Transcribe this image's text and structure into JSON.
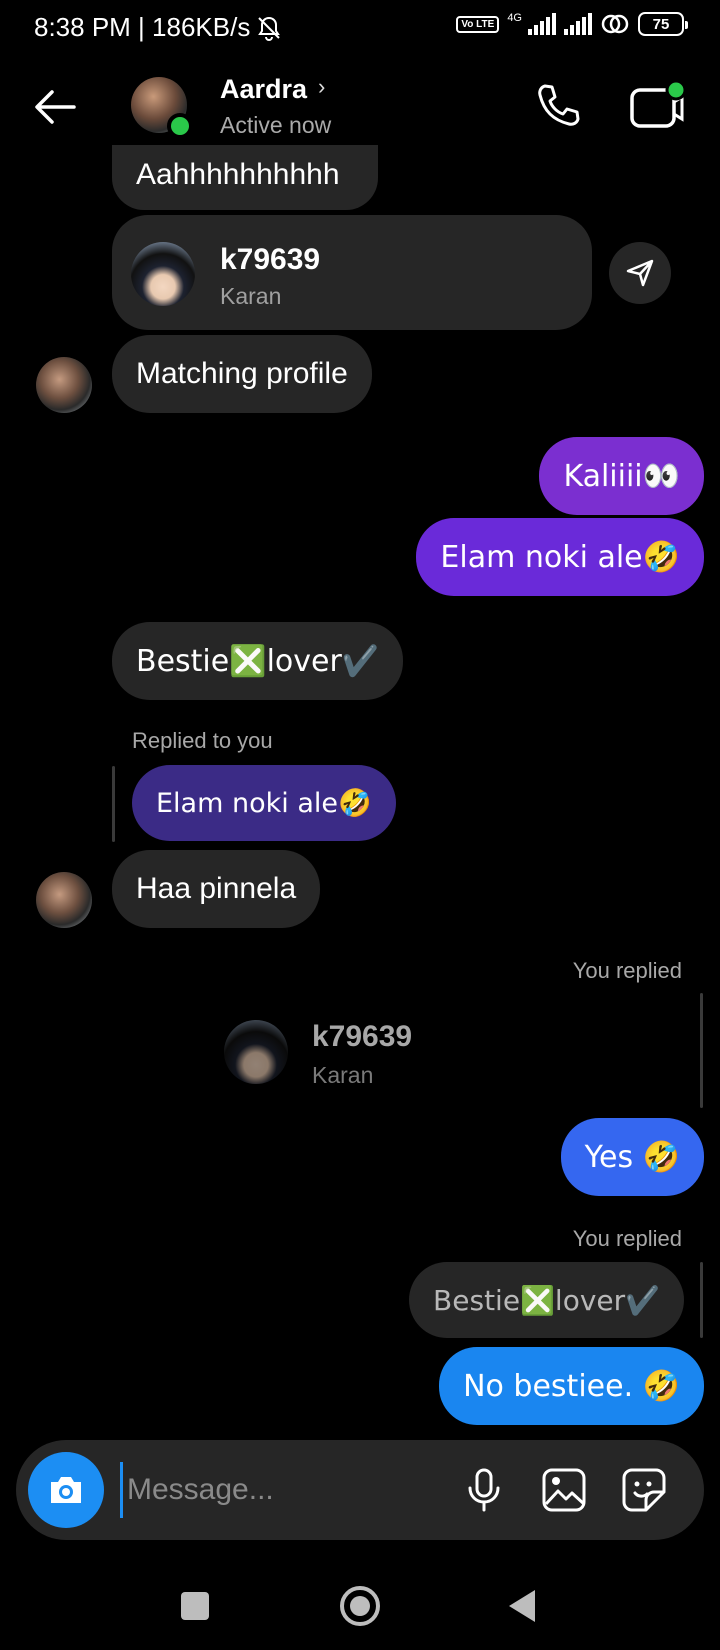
{
  "status_bar": {
    "time_speed": "8:38 PM | 186KB/s",
    "volte": "Vo LTE",
    "network": "4G",
    "battery": "75"
  },
  "header": {
    "contact_name": "Aardra",
    "chevron": "›",
    "active_status": "Active now"
  },
  "messages": {
    "m1": "Aahhhhhhhhhh",
    "shared_profile_1": {
      "username": "k79639",
      "name": "Karan"
    },
    "m2": "Matching profile",
    "m3": "Kaliiii👀",
    "m4": "Elam noki ale🤣",
    "m5": "Bestie❎lover✔️",
    "reply_label_1": "Replied to you",
    "quoted_1": "Elam noki ale🤣",
    "m6": "Haa pinnela",
    "reply_label_2": "You replied",
    "shared_profile_2": {
      "username": "k79639",
      "name": "Karan"
    },
    "m7": "Yes 🤣",
    "reply_label_3": "You replied",
    "quoted_2": "Bestie❎lover✔️",
    "m8": "No bestiee. 🤣"
  },
  "composer": {
    "placeholder": "Message..."
  },
  "icons": {
    "back": "arrow-left-icon",
    "call": "phone-icon",
    "video": "video-call-icon",
    "share": "send-icon",
    "camera": "camera-icon",
    "mic": "microphone-icon",
    "gallery": "image-icon",
    "sticker": "sticker-icon"
  },
  "colors": {
    "background": "#000000",
    "bubble_gray": "#262626",
    "bubble_purple": "#7b2fd0",
    "bubble_blue": "#3567f0",
    "bubble_blue2": "#1a86f0",
    "accent_blue": "#1c8ef3",
    "online_green": "#2ac84a"
  }
}
